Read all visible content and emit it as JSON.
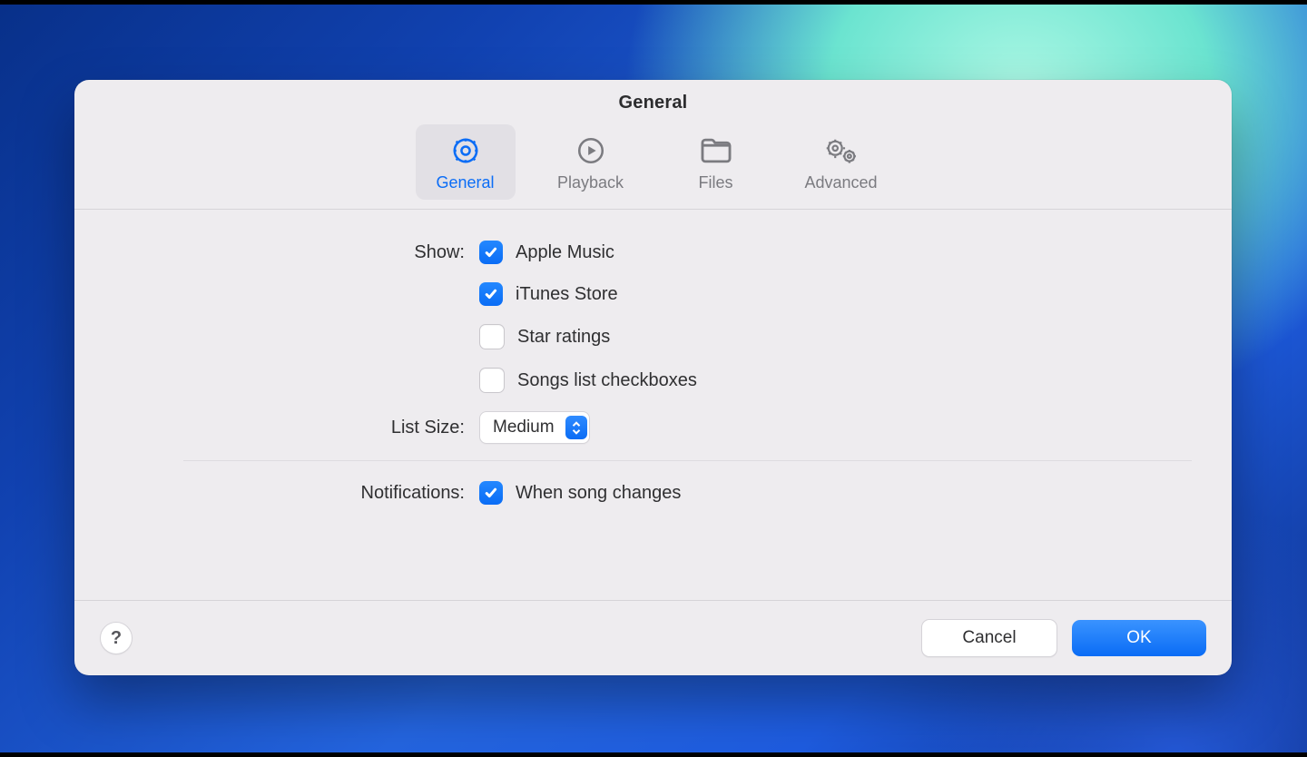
{
  "window": {
    "title": "General"
  },
  "tabs": {
    "general": {
      "label": "General",
      "selected": true
    },
    "playback": {
      "label": "Playback",
      "selected": false
    },
    "files": {
      "label": "Files",
      "selected": false
    },
    "advanced": {
      "label": "Advanced",
      "selected": false
    }
  },
  "sections": {
    "show": {
      "label": "Show:",
      "apple_music": {
        "label": "Apple Music",
        "checked": true
      },
      "itunes_store": {
        "label": "iTunes Store",
        "checked": true
      },
      "star_ratings": {
        "label": "Star ratings",
        "checked": false
      },
      "songs_checkboxes": {
        "label": "Songs list checkboxes",
        "checked": false
      }
    },
    "list_size": {
      "label": "List Size:",
      "value": "Medium"
    },
    "notifications": {
      "label": "Notifications:",
      "when_song_changes": {
        "label": "When song changes",
        "checked": true
      }
    }
  },
  "footer": {
    "help": "?",
    "cancel": "Cancel",
    "ok": "OK"
  }
}
